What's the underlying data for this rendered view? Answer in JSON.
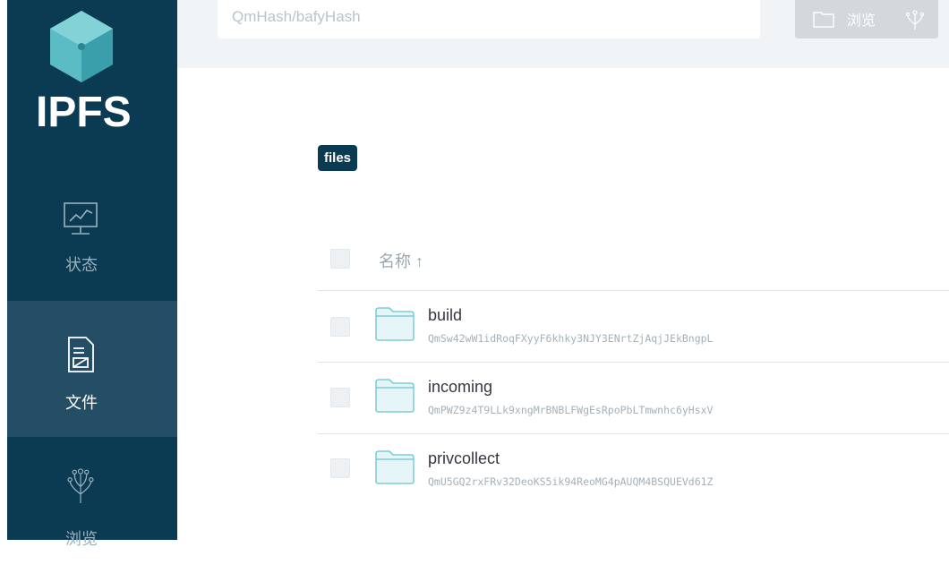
{
  "sidebar": {
    "brand": "IPFS",
    "items": [
      {
        "label": "状态",
        "icon": "status-monitor-icon"
      },
      {
        "label": "文件",
        "icon": "files-document-icon",
        "active": true
      },
      {
        "label": "浏览",
        "icon": "explore-tree-icon"
      }
    ]
  },
  "search": {
    "placeholder": "QmHash/bafyHash",
    "button_label": "浏览"
  },
  "breadcrumb": {
    "label": "files"
  },
  "table": {
    "header_name": "名称 ↑",
    "rows": [
      {
        "name": "build",
        "hash": "QmSw42wW1idRoqFXyyF6khky3NJY3ENrtZjAqjJEkBngpL"
      },
      {
        "name": "incoming",
        "hash": "QmPWZ9z4T9LLk9xngMrBNBLFWgEsRpoPbLTmwnhc6yHsxV"
      },
      {
        "name": "privcollect",
        "hash": "QmU5GQ2rxFRv32DeoKS5ik94ReoMG4pAUQM4BSQUEVd61Z"
      }
    ]
  },
  "colors": {
    "sidebar": "#0b3a53",
    "sidebar_active": "#244e66",
    "accent": "#69c4cd"
  }
}
